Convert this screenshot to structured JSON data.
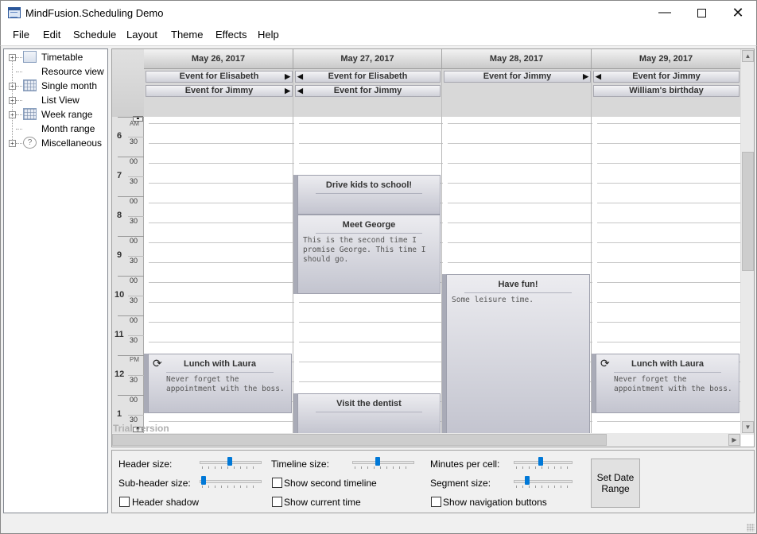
{
  "window": {
    "title": "MindFusion.Scheduling Demo"
  },
  "menu": [
    "File",
    "Edit",
    "Schedule",
    "Layout",
    "Theme",
    "Effects",
    "Help"
  ],
  "tree": {
    "items": [
      {
        "label": "Timetable",
        "icon": "timetable-icon",
        "expandable": true
      },
      {
        "label": "Resource view",
        "icon": "",
        "expandable": false
      },
      {
        "label": "Single month",
        "icon": "calendar-month-icon",
        "expandable": true
      },
      {
        "label": "List View",
        "icon": "",
        "expandable": true
      },
      {
        "label": "Week range",
        "icon": "calendar-week-icon",
        "expandable": true
      },
      {
        "label": "Month range",
        "icon": "",
        "expandable": false
      },
      {
        "label": "Miscellaneous",
        "icon": "help-icon",
        "expandable": true
      }
    ]
  },
  "schedule": {
    "days": [
      "May 26, 2017",
      "May 27, 2017",
      "May 28, 2017",
      "May 29, 2017"
    ],
    "allday": {
      "d0r0": "Event for Elisabeth",
      "d0r1": "Event for Jimmy",
      "d1r0": "Event for Elisabeth",
      "d1r1": "Event for Jimmy",
      "d2r0": "Event for Jimmy",
      "d3r0": "Event for Jimmy",
      "d3r1": "William's birthday"
    },
    "hours": [
      "6",
      "7",
      "8",
      "9",
      "10",
      "11",
      "12",
      "1"
    ],
    "minutes": {
      "half": "30",
      "zero": "00"
    },
    "am": "AM",
    "pm": "PM",
    "appointments": {
      "drive": {
        "title": "Drive kids to school!",
        "body": ""
      },
      "george": {
        "title": "Meet George",
        "body": "This is the second time I promise George. This time I should go."
      },
      "fun": {
        "title": "Have fun!",
        "body": "Some leisure time."
      },
      "lunch1": {
        "title": "Lunch with Laura",
        "body": "Never forget the appointment with the boss."
      },
      "lunch2": {
        "title": "Lunch with Laura",
        "body": "Never forget the appointment with the boss."
      },
      "dentist": {
        "title": "Visit the dentist",
        "body": ""
      }
    },
    "watermark": "Trial version"
  },
  "settings": {
    "header_size": "Header size:",
    "subheader_size": "Sub-header size:",
    "header_shadow": "Header shadow",
    "timeline_size": "Timeline size:",
    "show_second_timeline": "Show second timeline",
    "show_current_time": "Show current time",
    "minutes_per_cell": "Minutes per cell:",
    "segment_size": "Segment size:",
    "show_nav_buttons": "Show navigation buttons",
    "set_date_range": "Set Date Range",
    "levels": {
      "header_size": 0.48,
      "subheader_size": 0.03,
      "timeline_size": 0.4,
      "minutes_per_cell": 0.45,
      "segment_size": 0.2
    }
  },
  "colors": {
    "accent": "#0078d7",
    "appointment": "#c3c4cf",
    "header": "#c9c9c9"
  }
}
